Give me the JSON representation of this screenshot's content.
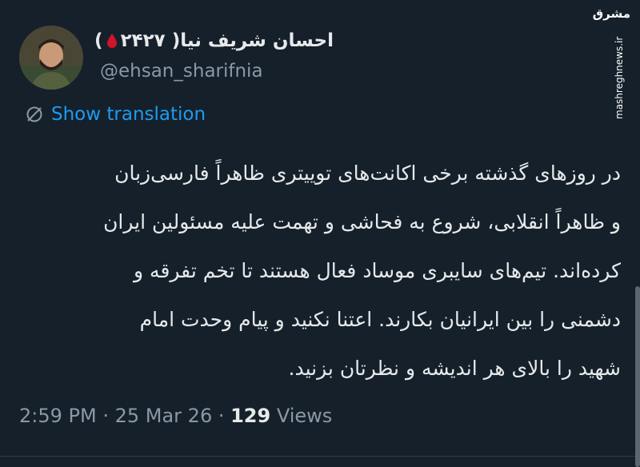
{
  "author": {
    "display_name": "احسان شریف نیا( ۲۴۲۷",
    "display_name_suffix": ")",
    "handle": "@ehsan_sharifnia"
  },
  "watermark": {
    "logo": "مشرق",
    "url": "mashreghnews.ir"
  },
  "translate": {
    "label": "Show translation",
    "icon": "globe-slash-icon"
  },
  "tweet": {
    "lines": [
      "در روزهای گذشته برخی اکانت‌های توییتری ظاهراً فارسی‌زبان",
      "و ظاهراً انقلابی، شروع به فحاشی و تهمت علیه مسئولین ایران",
      "کرده‌اند. تیم‌های سایبری موساد فعال هستند تا تخم تفرقه و",
      "دشمنی را بین ایرانیان بکارند. اعتنا نکنید و پیام وحدت امام",
      "شهید را بالای هر اندیشه و نظرتان بزنید."
    ]
  },
  "meta": {
    "time": "2:59 PM",
    "sep1": " · ",
    "date": "25 Mar 26",
    "sep2": " · ",
    "views_count": "129",
    "views_label": " Views"
  },
  "colors": {
    "background": "#15202b",
    "text": "#e7e9ea",
    "muted": "#8b98a5",
    "link": "#1d9bf0",
    "drop": "#d0142c"
  }
}
